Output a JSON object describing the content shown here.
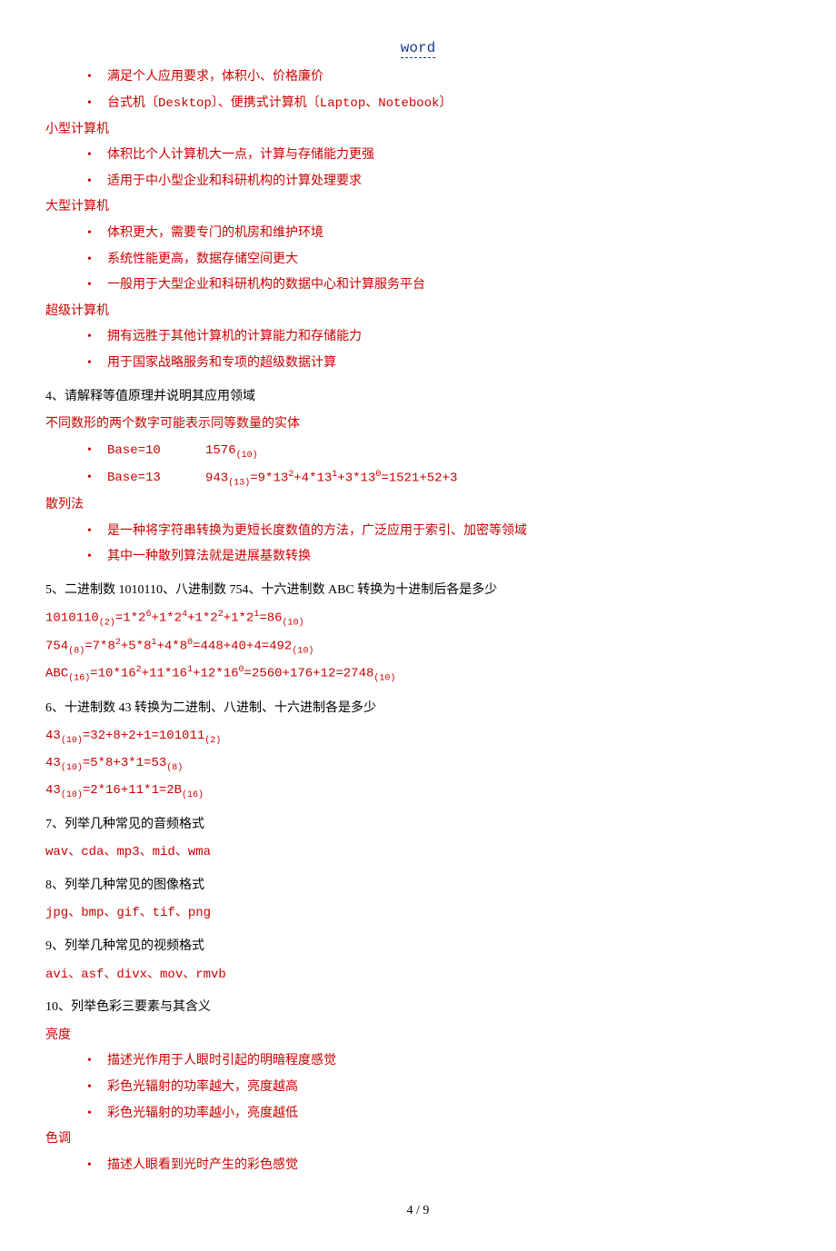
{
  "header": {
    "link": "word"
  },
  "s1": {
    "b1": "满足个人应用要求，体积小、价格廉价",
    "b2": "台式机〔Desktop〕、便携式计算机〔Laptop、Notebook〕"
  },
  "s2": {
    "title": "小型计算机",
    "b1": "体积比个人计算机大一点，计算与存储能力更强",
    "b2": "适用于中小型企业和科研机构的计算处理要求"
  },
  "s3": {
    "title": "大型计算机",
    "b1": "体积更大，需要专门的机房和维护环境",
    "b2": "系统性能更高，数据存储空间更大",
    "b3": "一般用于大型企业和科研机构的数据中心和计算服务平台"
  },
  "s4": {
    "title": "超级计算机",
    "b1": "拥有远胜于其他计算机的计算能力和存储能力",
    "b2": "用于国家战略服务和专项的超级数据计算"
  },
  "q4": {
    "title": "4、请解释等值原理并说明其应用领域",
    "line1": "不同数形的两个数字可能表示同等数量的实体",
    "base10_label": "Base=10",
    "base13_label": "Base=13",
    "hash_title": "散列法",
    "hb1": "是一种将字符串转换为更短长度数值的方法，广泛应用于索引、加密等领域",
    "hb2": "其中一种散列算法就是进展基数转换"
  },
  "q5": {
    "title": "5、二进制数 1010110、八进制数 754、十六进制数 ABC 转换为十进制后各是多少"
  },
  "q6": {
    "title": "6、十进制数 43 转换为二进制、八进制、十六进制各是多少"
  },
  "q7": {
    "title": "7、列举几种常见的音频格式",
    "ans": "wav、cda、mp3、mid、wma"
  },
  "q8": {
    "title": "8、列举几种常见的图像格式",
    "ans": "jpg、bmp、gif、tif、png"
  },
  "q9": {
    "title": "9、列举几种常见的视频格式",
    "ans": "avi、asf、divx、mov、rmvb"
  },
  "q10": {
    "title": "10、列举色彩三要素与其含义",
    "lum_title": "亮度",
    "lb1": "描述光作用于人眼时引起的明暗程度感觉",
    "lb2": "彩色光辐射的功率越大，亮度越高",
    "lb3": "彩色光辐射的功率越小，亮度越低",
    "hue_title": "色调",
    "hb1": "描述人眼看到光时产生的彩色感觉"
  },
  "pager": {
    "text": "4 / 9"
  }
}
